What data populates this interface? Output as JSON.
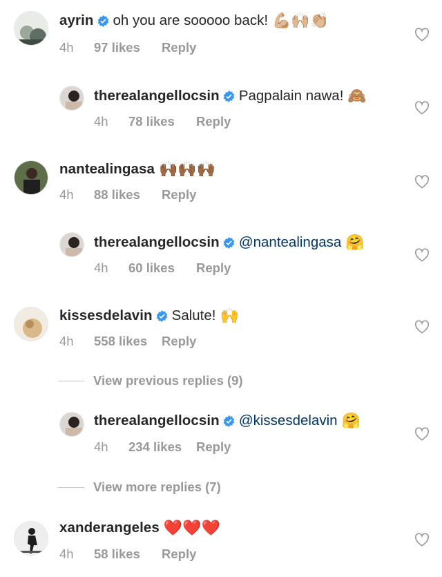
{
  "comments": [
    {
      "username": "ayrin",
      "verified": true,
      "text": "oh you are sooooo back!",
      "emoji": "💪🏼🙌🏼👏🏼",
      "time": "4h",
      "likes": "97 likes",
      "reply": "Reply"
    },
    {
      "username": "therealangellocsin",
      "verified": true,
      "text": "Pagpalain nawa!",
      "emoji": "🙈",
      "time": "4h",
      "likes": "78 likes",
      "reply": "Reply"
    },
    {
      "username": "nantealingasa",
      "verified": false,
      "text": "",
      "emoji": "🙌🏾🙌🏾🙌🏾",
      "time": "4h",
      "likes": "88 likes",
      "reply": "Reply"
    },
    {
      "username": "therealangellocsin",
      "verified": true,
      "mention": "@nantealingasa",
      "emoji": "🤗",
      "time": "4h",
      "likes": "60 likes",
      "reply": "Reply"
    },
    {
      "username": "kissesdelavin",
      "verified": true,
      "text": "Salute!",
      "emoji": "🙌",
      "time": "4h",
      "likes": "558 likes",
      "reply": "Reply"
    },
    {
      "username": "therealangellocsin",
      "verified": true,
      "mention": "@kissesdelavin",
      "emoji": "🤗",
      "time": "4h",
      "likes": "234 likes",
      "reply": "Reply"
    },
    {
      "username": "xanderangeles",
      "verified": false,
      "text": "",
      "emoji": "❤️❤️❤️",
      "time": "4h",
      "likes": "58 likes",
      "reply": "Reply"
    }
  ],
  "view_previous": "View previous replies (9)",
  "view_more": "View more replies (7)",
  "colors": {
    "username": "#262626",
    "meta": "#999999",
    "mention": "#003569",
    "verified": "#3897f0"
  }
}
